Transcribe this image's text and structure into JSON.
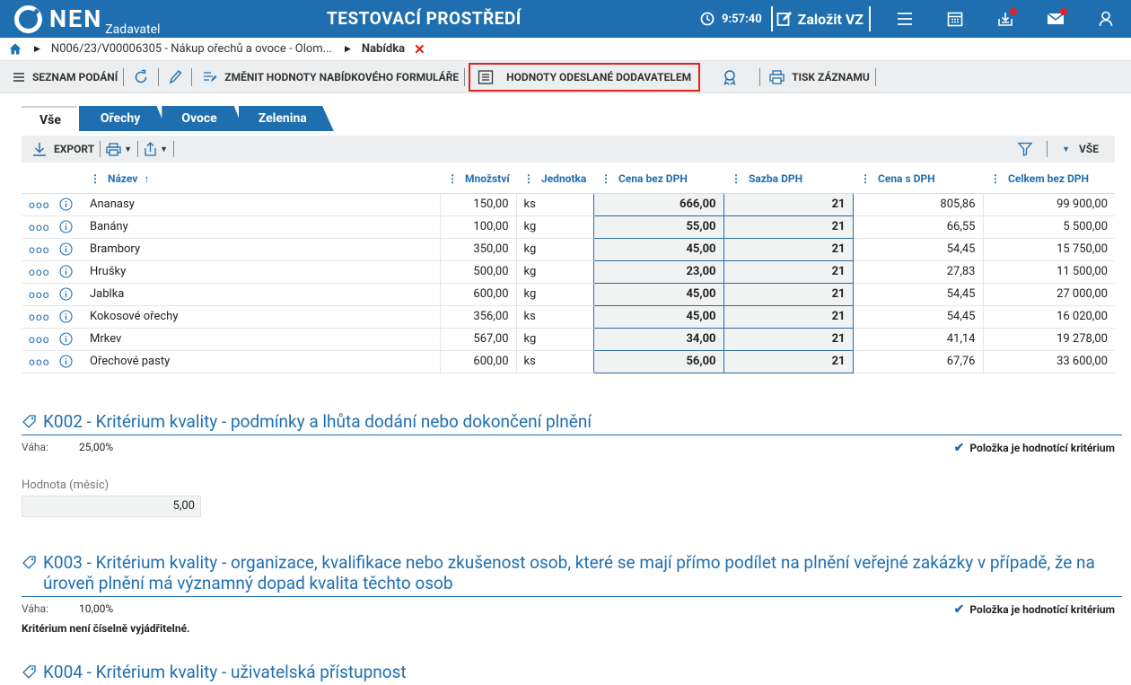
{
  "header": {
    "logo_text": "NEN",
    "logo_sub": "Zadavatel",
    "env_title": "TESTOVACÍ PROSTŘEDÍ",
    "time": "9:57:40",
    "create_label": "Založit VZ"
  },
  "breadcrumb": {
    "item1": "N006/23/V00006305 - Nákup ořechů a ovoce - Olom...",
    "current": "Nabídka",
    "close": "✕"
  },
  "toolbar": {
    "list_label": "SEZNAM PODÁNÍ",
    "change_label": "ZMĚNIT HODNOTY NABÍDKOVÉHO FORMULÁŘE",
    "sent_label": "HODNOTY ODESLANÉ DODAVATELEM",
    "print_label": "TISK ZÁZNAMU"
  },
  "tabs": [
    {
      "label": "Vše"
    },
    {
      "label": "Ořechy"
    },
    {
      "label": "Ovoce"
    },
    {
      "label": "Zelenina"
    }
  ],
  "grid_toolbar": {
    "export_label": "EXPORT",
    "filter_label": "VŠE"
  },
  "table": {
    "columns": [
      "Název",
      "Množství",
      "Jednotka",
      "Cena bez DPH",
      "Sazba DPH",
      "Cena s DPH",
      "Celkem bez DPH"
    ],
    "rows": [
      {
        "name": "Ananasy",
        "qty": "150,00",
        "unit": "ks",
        "price": "666,00",
        "vat": "21",
        "price_vat": "805,86",
        "total": "99 900,00"
      },
      {
        "name": "Banány",
        "qty": "100,00",
        "unit": "kg",
        "price": "55,00",
        "vat": "21",
        "price_vat": "66,55",
        "total": "5 500,00"
      },
      {
        "name": "Brambory",
        "qty": "350,00",
        "unit": "kg",
        "price": "45,00",
        "vat": "21",
        "price_vat": "54,45",
        "total": "15 750,00"
      },
      {
        "name": "Hrušky",
        "qty": "500,00",
        "unit": "kg",
        "price": "23,00",
        "vat": "21",
        "price_vat": "27,83",
        "total": "11 500,00"
      },
      {
        "name": "Jablka",
        "qty": "600,00",
        "unit": "kg",
        "price": "45,00",
        "vat": "21",
        "price_vat": "54,45",
        "total": "27 000,00"
      },
      {
        "name": "Kokosové ořechy",
        "qty": "356,00",
        "unit": "ks",
        "price": "45,00",
        "vat": "21",
        "price_vat": "54,45",
        "total": "16 020,00"
      },
      {
        "name": "Mrkev",
        "qty": "567,00",
        "unit": "kg",
        "price": "34,00",
        "vat": "21",
        "price_vat": "41,14",
        "total": "19 278,00"
      },
      {
        "name": "Ořechové pasty",
        "qty": "600,00",
        "unit": "ks",
        "price": "56,00",
        "vat": "21",
        "price_vat": "67,76",
        "total": "33 600,00"
      }
    ]
  },
  "criteria": {
    "k002": {
      "title": "K002 - Kritérium kvality - podmínky a lhůta dodání nebo dokončení plnění",
      "weight_label": "Váha:",
      "weight": "25,00%",
      "flag": "Položka je hodnotící kritérium",
      "field_label": "Hodnota (měsíc)",
      "field_value": "5,00"
    },
    "k003": {
      "title": "K003 - Kritérium kvality - organizace, kvalifikace nebo zkušenost osob, které se mají přímo podílet na plnění veřejné zakázky v případě, že na úroveň plnění má významný dopad kvalita těchto osob",
      "weight_label": "Váha:",
      "weight": "10,00%",
      "flag": "Položka je hodnotící kritérium",
      "note": "Kritérium není číselně vyjádřitelné."
    },
    "k004": {
      "title": "K004 - Kritérium kvality - uživatelská přístupnost"
    }
  }
}
